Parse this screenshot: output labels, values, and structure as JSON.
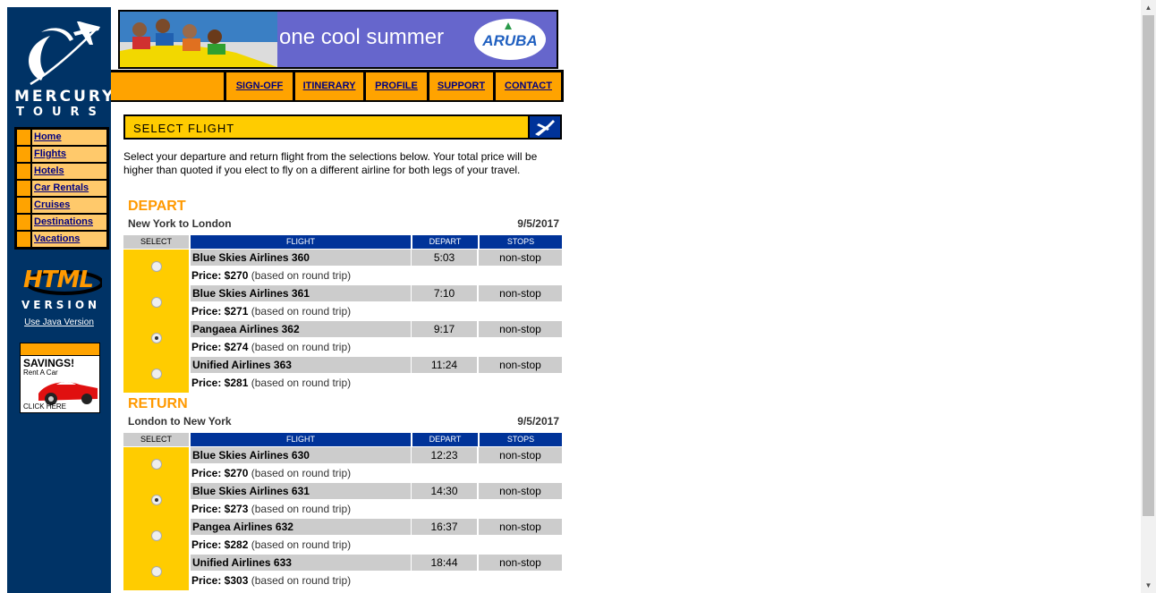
{
  "brand": {
    "name_line1": "MERCURY",
    "name_line2": "TOURS"
  },
  "sidebar": {
    "nav": [
      "Home",
      "Flights",
      "Hotels",
      "Car Rentals",
      "Cruises",
      "Destinations",
      "Vacations"
    ],
    "html_version_line1": "HTML",
    "html_version_line2": "VERSION",
    "use_java_link": "Use Java Version",
    "ad": {
      "headline": "SAVINGS!",
      "sub": "Rent A Car",
      "cta": "CLICK HERE"
    }
  },
  "banner": {
    "tagline": "one cool summer",
    "logo_text": "ARUBA"
  },
  "topnav": [
    "SIGN-OFF",
    "ITINERARY",
    "PROFILE",
    "SUPPORT",
    "CONTACT"
  ],
  "header": {
    "title": "SELECT FLIGHT"
  },
  "intro": "Select your departure and return flight from the selections below. Your total price will be higher than quoted if you elect to fly on a different airline for both legs of your travel.",
  "columns": {
    "select": "SELECT",
    "flight": "FLIGHT",
    "depart": "DEPART",
    "stops": "STOPS"
  },
  "depart": {
    "title": "DEPART",
    "route": "New York to London",
    "date": "9/5/2017",
    "flights": [
      {
        "name": "Blue Skies Airlines 360",
        "time": "5:03",
        "stops": "non-stop",
        "price": "Price: $270",
        "note": "(based on round trip)",
        "selected": false
      },
      {
        "name": "Blue Skies Airlines 361",
        "time": "7:10",
        "stops": "non-stop",
        "price": "Price: $271",
        "note": "(based on round trip)",
        "selected": false
      },
      {
        "name": "Pangaea Airlines 362",
        "time": "9:17",
        "stops": "non-stop",
        "price": "Price: $274",
        "note": "(based on round trip)",
        "selected": true
      },
      {
        "name": "Unified Airlines 363",
        "time": "11:24",
        "stops": "non-stop",
        "price": "Price: $281",
        "note": "(based on round trip)",
        "selected": false
      }
    ]
  },
  "return": {
    "title": "RETURN",
    "route": "London to New York",
    "date": "9/5/2017",
    "flights": [
      {
        "name": "Blue Skies Airlines 630",
        "time": "12:23",
        "stops": "non-stop",
        "price": "Price: $270",
        "note": "(based on round trip)",
        "selected": false
      },
      {
        "name": "Blue Skies Airlines 631",
        "time": "14:30",
        "stops": "non-stop",
        "price": "Price: $273",
        "note": "(based on round trip)",
        "selected": true
      },
      {
        "name": "Pangea Airlines 632",
        "time": "16:37",
        "stops": "non-stop",
        "price": "Price: $282",
        "note": "(based on round trip)",
        "selected": false
      },
      {
        "name": "Unified Airlines 633",
        "time": "18:44",
        "stops": "non-stop",
        "price": "Price: $303",
        "note": "(based on round trip)",
        "selected": false
      }
    ]
  },
  "colors": {
    "sidebar_bg": "#003366",
    "accent_orange": "#ffa300",
    "header_yellow": "#ffcc00",
    "table_header_blue": "#003399",
    "section_title": "#ff9900"
  }
}
